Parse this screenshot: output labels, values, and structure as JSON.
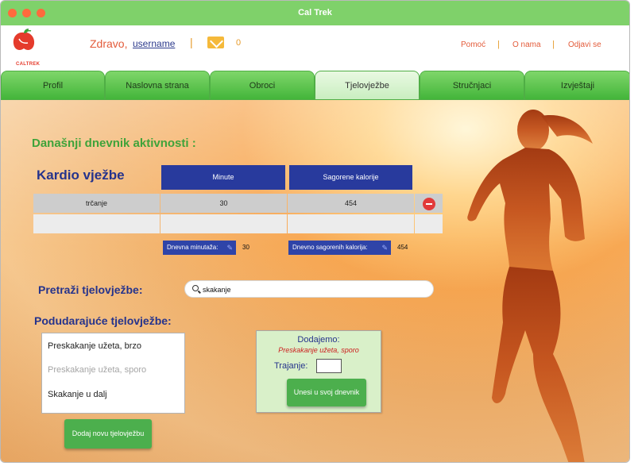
{
  "window": {
    "title": "Cal Trek"
  },
  "logo": {
    "text": "CALTREK"
  },
  "header": {
    "greeting": "Zdravo,",
    "username": "username",
    "message_count": "0",
    "links": [
      "Pomoć",
      "O nama",
      "Odjavi se"
    ]
  },
  "nav": {
    "tabs": [
      "Profil",
      "Naslovna strana",
      "Obroci",
      "Tjelovježbe",
      "Stručnjaci",
      "Izvještaji"
    ],
    "active": "Tjelovježbe"
  },
  "log": {
    "heading": "Današnji dnevnik aktivnosti :",
    "cardio_title": "Kardio vježbe",
    "col_minutes": "Minute",
    "col_calories": "Sagorene kalorije",
    "rows": [
      {
        "name": "trčanje",
        "minutes": "30",
        "calories": "454"
      }
    ],
    "total_minutes_label": "Dnevna minutaža:",
    "total_minutes": "30",
    "total_calories_label": "Dnevno sagorenih kalorija:",
    "total_calories": "454"
  },
  "search": {
    "heading": "Pretraži tjelovježbe:",
    "value": "skakanje"
  },
  "matches": {
    "heading": "Podudarajuće tjelovježbe:",
    "items": [
      "Preskakanje užeta, brzo",
      "Preskakanje užeta, sporo",
      "Skakanje u dalj"
    ],
    "add_new": "Dodaj novu tjelovježbu"
  },
  "add_panel": {
    "label": "Dodajemo:",
    "selected": "Preskakanje užeta, sporo",
    "duration_label": "Trajanje:",
    "duration_value": "",
    "submit": "Unesi u svoj dnevnik"
  },
  "colors": {
    "titlebar": "#7fd16a",
    "accent_blue": "#283a9d",
    "accent_green": "#4caf4d",
    "accent_red": "#cc1f1f"
  },
  "icons": [
    "close-dot-icon",
    "minimize-dot-icon",
    "maximize-dot-icon",
    "mail-icon",
    "search-icon",
    "remove-icon",
    "edit-pencil-icon"
  ]
}
